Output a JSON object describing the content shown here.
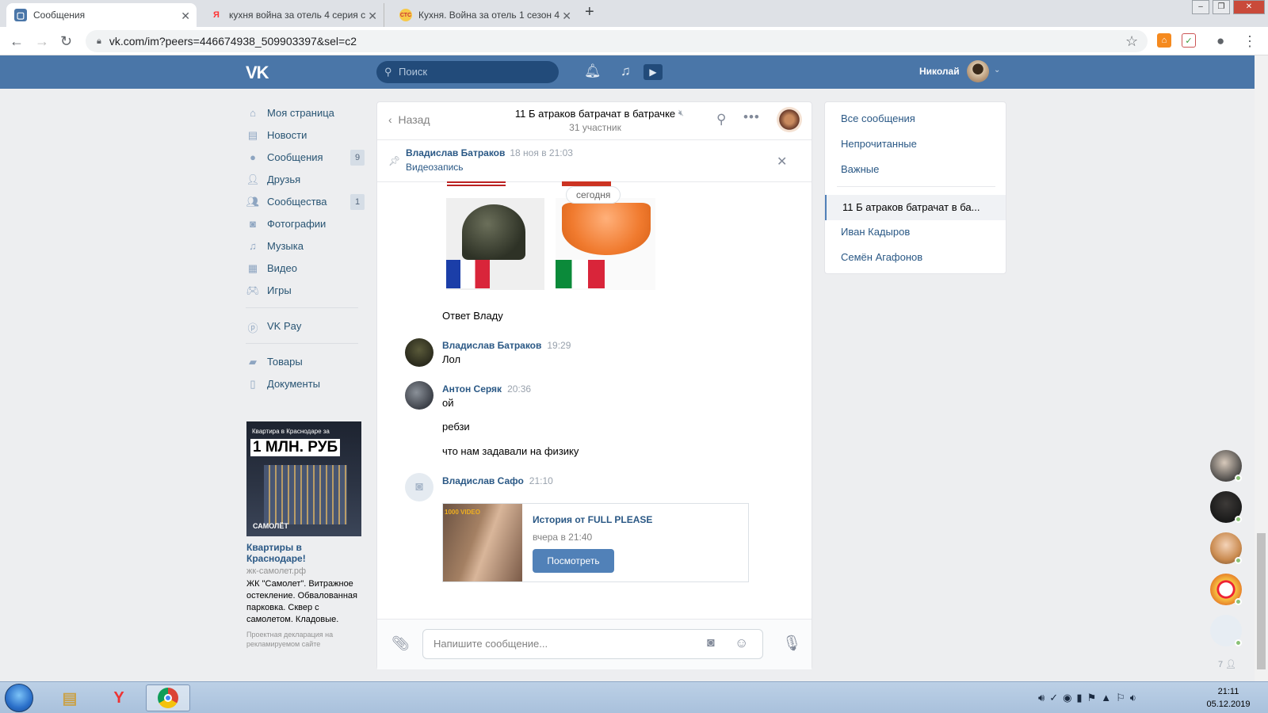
{
  "browser": {
    "tabs": [
      {
        "title": "Сообщения",
        "active": true
      },
      {
        "title": "кухня война за отель 4 серия с",
        "active": false
      },
      {
        "title": "Кухня. Война за отель 1 сезон 4",
        "active": false
      }
    ],
    "new_tab": "+",
    "url": "vk.com/im?peers=446674938_509903397&sel=c2"
  },
  "vk_header": {
    "logo": "VK",
    "search_placeholder": "Поиск",
    "user_name": "Николай"
  },
  "left_menu": {
    "items": [
      {
        "label": "Моя страница",
        "icon": "home-icon"
      },
      {
        "label": "Новости",
        "icon": "news-icon"
      },
      {
        "label": "Сообщения",
        "icon": "messages-icon",
        "badge": "9"
      },
      {
        "label": "Друзья",
        "icon": "friends-icon"
      },
      {
        "label": "Сообщества",
        "icon": "groups-icon",
        "badge": "1"
      },
      {
        "label": "Фотографии",
        "icon": "camera-icon"
      },
      {
        "label": "Музыка",
        "icon": "music-icon"
      },
      {
        "label": "Видео",
        "icon": "video-icon"
      },
      {
        "label": "Игры",
        "icon": "gamepad-icon"
      }
    ],
    "vkpay": "VK Pay",
    "extra": [
      {
        "label": "Товары",
        "icon": "bag-icon"
      },
      {
        "label": "Документы",
        "icon": "document-icon"
      }
    ]
  },
  "ad": {
    "image_line1": "Квартира в Краснодаре за",
    "image_line2": "1 МЛН. РУБ",
    "image_logo": "САМОЛЁТ",
    "title": "Квартиры в Краснодаре!",
    "url": "жк-самолет.рф",
    "text": "ЖК \"Самолет\". Витражное остекление. Обвалованная парковка. Сквер с самолетом. Кладовые.",
    "note": "Проектная декларация на рекламируемом сайте"
  },
  "chat": {
    "back_label": "Назад",
    "title": "11 Б атраков батрачат в батрачке",
    "subtitle": "31 участник",
    "pinned": {
      "author": "Владислав Батраков",
      "time": "18 ноя в 21:03",
      "text": "Видеозапись"
    },
    "date_divider": "сегодня",
    "messages": [
      {
        "text": "Ответ Владу"
      },
      {
        "author": "Владислав Батраков",
        "time": "19:29",
        "lines": [
          "Лол"
        ]
      },
      {
        "author": "Антон Серяк",
        "time": "20:36",
        "lines": [
          "ой",
          "ребзи",
          "что нам задавали на физику"
        ]
      },
      {
        "author": "Владислав Сафо",
        "time": "21:10"
      }
    ],
    "story_card": {
      "image_label": "1000 VIDEO",
      "title": "История от FULL PLEASE",
      "subtitle": "вчера в 21:40",
      "button": "Посмотреть"
    },
    "input_placeholder": "Напишите сообщение..."
  },
  "right_panel": {
    "filters": [
      "Все сообщения",
      "Непрочитанные",
      "Важные"
    ],
    "conversations": [
      "11 Б атраков батрачат в ба...",
      "Иван Кадыров",
      "Семён Агафонов"
    ]
  },
  "friends_online_count": "7",
  "taskbar": {
    "time": "21:11",
    "date": "05.12.2019"
  },
  "colors": {
    "vk_blue": "#4a76a8",
    "link": "#2a5885",
    "button": "#5181b8"
  }
}
